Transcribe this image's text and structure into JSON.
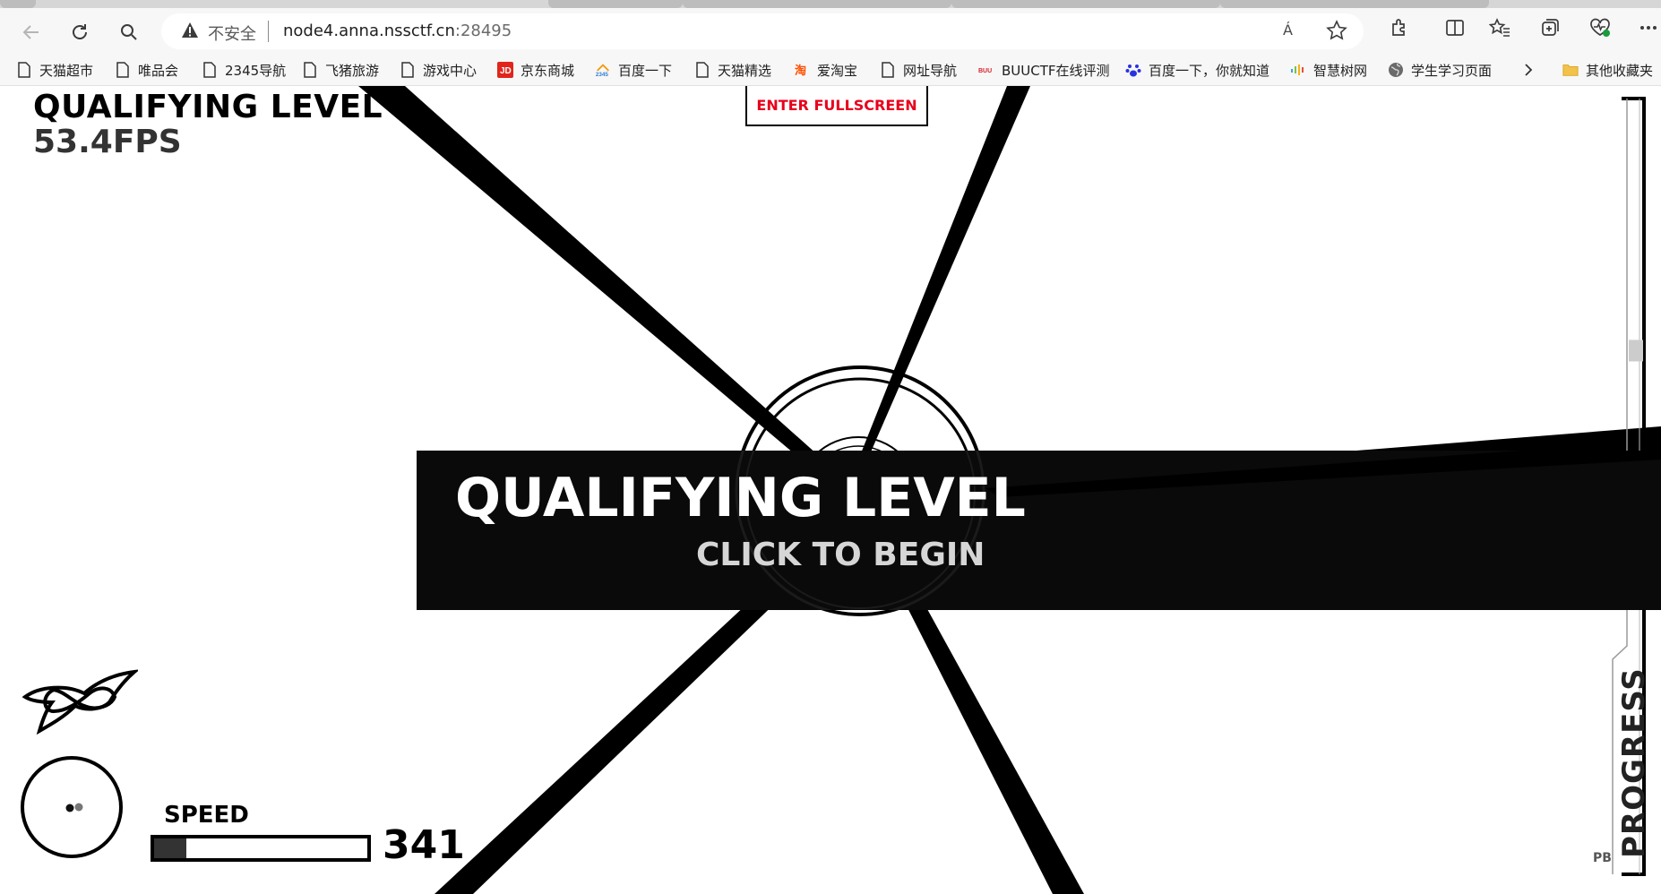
{
  "browser": {
    "security_label": "不安全",
    "url_host": "node4.anna.nssctf.cn",
    "url_port": ":28495",
    "read_aloud_label": "Á",
    "icons": {
      "back": "back-arrow-icon",
      "reload": "reload-icon",
      "search": "search-icon",
      "warning": "warning-icon",
      "favorite": "star-icon",
      "extensions": "puzzle-icon",
      "split": "split-screen-icon",
      "favorites": "favorites-icon",
      "collections": "collections-icon",
      "health": "browser-essentials-icon",
      "more": "more-icon"
    }
  },
  "bookmarks": [
    {
      "label": "天猫超市",
      "icon": "page-icon"
    },
    {
      "label": "唯品会",
      "icon": "page-icon"
    },
    {
      "label": "2345导航",
      "icon": "page-icon"
    },
    {
      "label": "飞猪旅游",
      "icon": "page-icon"
    },
    {
      "label": "游戏中心",
      "icon": "page-icon"
    },
    {
      "label": "京东商城",
      "icon": "jd-icon"
    },
    {
      "label": "百度一下",
      "icon": "2345-icon"
    },
    {
      "label": "天猫精选",
      "icon": "page-icon"
    },
    {
      "label": "爱淘宝",
      "icon": "taobao-icon"
    },
    {
      "label": "网址导航",
      "icon": "page-icon"
    },
    {
      "label": "BUUCTF在线评测",
      "icon": "buuctf-icon"
    },
    {
      "label": "百度一下，你就知道",
      "icon": "baidu-paw-icon"
    },
    {
      "label": "智慧树网",
      "icon": "zhihuishu-icon"
    },
    {
      "label": "学生学习页面",
      "icon": "globe-icon"
    }
  ],
  "bookmarks_overflow_icon": "chevron-right-icon",
  "bookmarks_other": {
    "label": "其他收藏夹",
    "icon": "folder-icon"
  },
  "game": {
    "level_title": "QUALIFYING LEVEL",
    "fps": "53.4FPS",
    "fullscreen_button": "ENTER FULLSCREEN",
    "banner_title": "QUALIFYING LEVEL",
    "banner_subtitle": "CLICK TO BEGIN",
    "speed_label": "SPEED",
    "speed_value": "341",
    "speed_fraction": 0.15,
    "progress_label": "PROGRESS",
    "pb_label": "PB",
    "progress_fraction": 0.2,
    "colors": {
      "accent_red": "#e8001c",
      "banner_bg": "#0a0a0a",
      "subtitle": "#d6d6d6"
    },
    "icons": {
      "ship": "ship-icon",
      "radar": "radar-icon"
    }
  }
}
